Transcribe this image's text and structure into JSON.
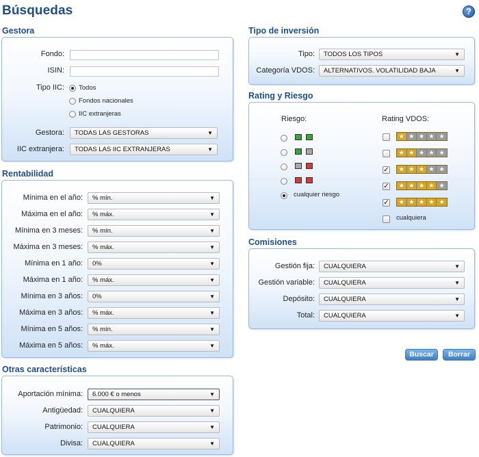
{
  "title": "Búsquedas",
  "help_icon": "?",
  "gestora": {
    "title": "Gestora",
    "fondo_label": "Fondo:",
    "fondo_value": "",
    "isin_label": "ISIN:",
    "isin_value": "",
    "tipo_label": "Tipo IIC:",
    "tipo_options": [
      "Todos",
      "Fondos nacionales",
      "IIC extranjeras"
    ],
    "tipo_selected": "Todos",
    "gestora_label": "Gestora:",
    "gestora_value": "TODAS LAS GESTORAS",
    "iic_label": "IIC extranjera:",
    "iic_value": "TODAS LAS IIC EXTRANJERAS"
  },
  "rentabilidad": {
    "title": "Rentabilidad",
    "rows": [
      {
        "label": "Mínima en el año:",
        "value": "% mín."
      },
      {
        "label": "Máxima en el año:",
        "value": "% máx."
      },
      {
        "label": "Mínima en 3 meses:",
        "value": "% mín."
      },
      {
        "label": "Máxima en 3 meses:",
        "value": "% máx."
      },
      {
        "label": "Mínima en 1 año:",
        "value": "0%"
      },
      {
        "label": "Máxima en 1 año:",
        "value": "% máx."
      },
      {
        "label": "Mínima en 3 años:",
        "value": "0%"
      },
      {
        "label": "Máxima en 3 años:",
        "value": "% máx."
      },
      {
        "label": "Mínima en 5 años:",
        "value": "% mín."
      },
      {
        "label": "Máxima en 5 años:",
        "value": "% máx."
      }
    ]
  },
  "otras": {
    "title": "Otras características",
    "rows": [
      {
        "label": "Aportación mínima:",
        "value": "6.000 € o menos"
      },
      {
        "label": "Antigüedad:",
        "value": "CUALQUIERA"
      },
      {
        "label": "Patrimonio:",
        "value": "CUALQUIERA"
      },
      {
        "label": "Divisa:",
        "value": "CUALQUIERA"
      }
    ]
  },
  "tipo_inversion": {
    "title": "Tipo de inversión",
    "tipo_label": "Tipo:",
    "tipo_value": "TODOS LOS TIPOS",
    "cat_label": "Categoría VDOS:",
    "cat_value": "ALTERNATIVOS. VOLATILIDAD BAJA"
  },
  "rating": {
    "title": "Rating y Riesgo",
    "riesgo_label": "Riesgo:",
    "riesgo_levels": [
      {
        "colors": [
          "green",
          "green"
        ],
        "selected": false
      },
      {
        "colors": [
          "green",
          "gray"
        ],
        "selected": false
      },
      {
        "colors": [
          "gray",
          "red"
        ],
        "selected": false
      },
      {
        "colors": [
          "red",
          "red"
        ],
        "selected": false
      }
    ],
    "riesgo_any_label": "cualquier riesgo",
    "riesgo_any_selected": true,
    "rating_label": "Rating VDOS:",
    "rating_levels": [
      {
        "stars": 1,
        "checked": false
      },
      {
        "stars": 2,
        "checked": false
      },
      {
        "stars": 3,
        "checked": true
      },
      {
        "stars": 4,
        "checked": true
      },
      {
        "stars": 5,
        "checked": true
      }
    ],
    "rating_any_label": "cualquiera",
    "rating_any_checked": false
  },
  "comisiones": {
    "title": "Comisiones",
    "rows": [
      {
        "label": "Gestión fija:",
        "value": "CUALQUIERA"
      },
      {
        "label": "Gestión variable:",
        "value": "CUALQUIERA"
      },
      {
        "label": "Depósito:",
        "value": "CUALQUIERA"
      },
      {
        "label": "Total:",
        "value": "CUALQUIERA"
      }
    ]
  },
  "buttons": {
    "search": "Buscar",
    "clear": "Borrar"
  },
  "colors": {
    "title": "#1f4e86",
    "panel_border": "#9ab8d8",
    "button": "#3e7fc4",
    "risk_green": "#3ca23c",
    "risk_gray": "#a9a9a9",
    "risk_red": "#d43a3a",
    "star_gold": "#d6a727",
    "star_grey": "#9a9a9a"
  }
}
